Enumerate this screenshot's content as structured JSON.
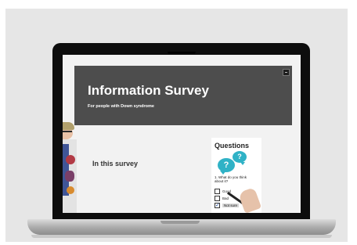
{
  "banner": {
    "title": "Information Survey",
    "subtitle": "For people with Down syndrome"
  },
  "section": {
    "heading": "In this survey"
  },
  "questions_card": {
    "title": "Questions",
    "bubble_large": "?",
    "bubble_small": "?",
    "question": "1. What do you think about it?",
    "options": [
      {
        "label": "Good",
        "checked": false
      },
      {
        "label": "Bad",
        "checked": false
      },
      {
        "label": "Not sure",
        "checked": true
      }
    ]
  },
  "colors": {
    "banner_bg": "#4d4d4d",
    "bubble": "#2fb2c6",
    "screen_bg": "#f2f2f2"
  },
  "icons": [
    "menu-icon"
  ]
}
